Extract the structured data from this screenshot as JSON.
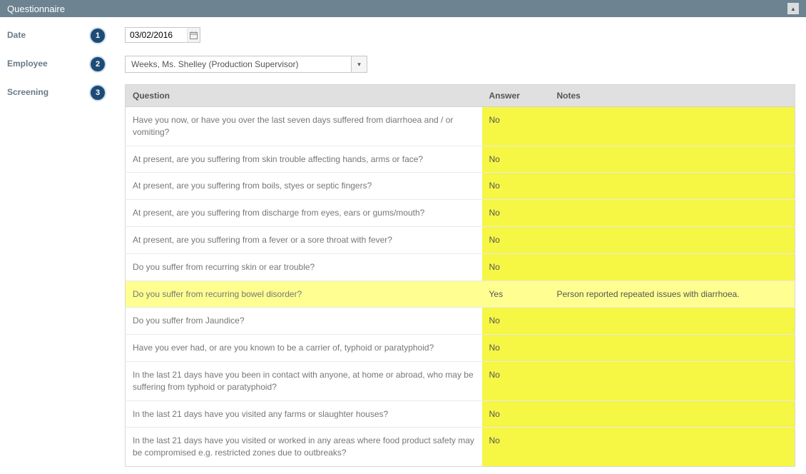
{
  "panel": {
    "title": "Questionnaire"
  },
  "labels": {
    "date": "Date",
    "employee": "Employee",
    "screening": "Screening"
  },
  "badges": {
    "b1": "1",
    "b2": "2",
    "b3": "3"
  },
  "fields": {
    "date": "03/02/2016",
    "employee": "Weeks, Ms. Shelley (Production Supervisor)"
  },
  "table": {
    "headers": {
      "question": "Question",
      "answer": "Answer",
      "notes": "Notes"
    },
    "rows": [
      {
        "q": "Have you now, or have you over the last seven days suffered from diarrhoea and / or vomiting?",
        "a": "No",
        "n": ""
      },
      {
        "q": "At present, are you suffering from skin trouble affecting hands, arms or face?",
        "a": "No",
        "n": ""
      },
      {
        "q": "At present, are you suffering from boils, styes or septic fingers?",
        "a": "No",
        "n": ""
      },
      {
        "q": "At present, are you suffering from discharge from eyes, ears or gums/mouth?",
        "a": "No",
        "n": ""
      },
      {
        "q": "At present, are you suffering from a fever or a sore throat with fever?",
        "a": "No",
        "n": ""
      },
      {
        "q": "Do you suffer from recurring skin or ear trouble?",
        "a": "No",
        "n": ""
      },
      {
        "q": "Do you suffer from recurring bowel disorder?",
        "a": "Yes",
        "n": "Person reported repeated issues with diarrhoea."
      },
      {
        "q": "Do you suffer from Jaundice?",
        "a": "No",
        "n": ""
      },
      {
        "q": "Have you ever had, or are you known to be a carrier of, typhoid or paratyphoid?",
        "a": "No",
        "n": ""
      },
      {
        "q": "In the last 21 days have you been in contact with anyone, at home or abroad, who may be suffering from typhoid or paratyphoid?",
        "a": "No",
        "n": ""
      },
      {
        "q": "In the last 21 days have you visited any farms or slaughter houses?",
        "a": "No",
        "n": ""
      },
      {
        "q": "In the last 21 days have you visited or worked in any areas where food product safety may be compromised e.g. restricted zones due to outbreaks?",
        "a": "No",
        "n": ""
      }
    ]
  }
}
